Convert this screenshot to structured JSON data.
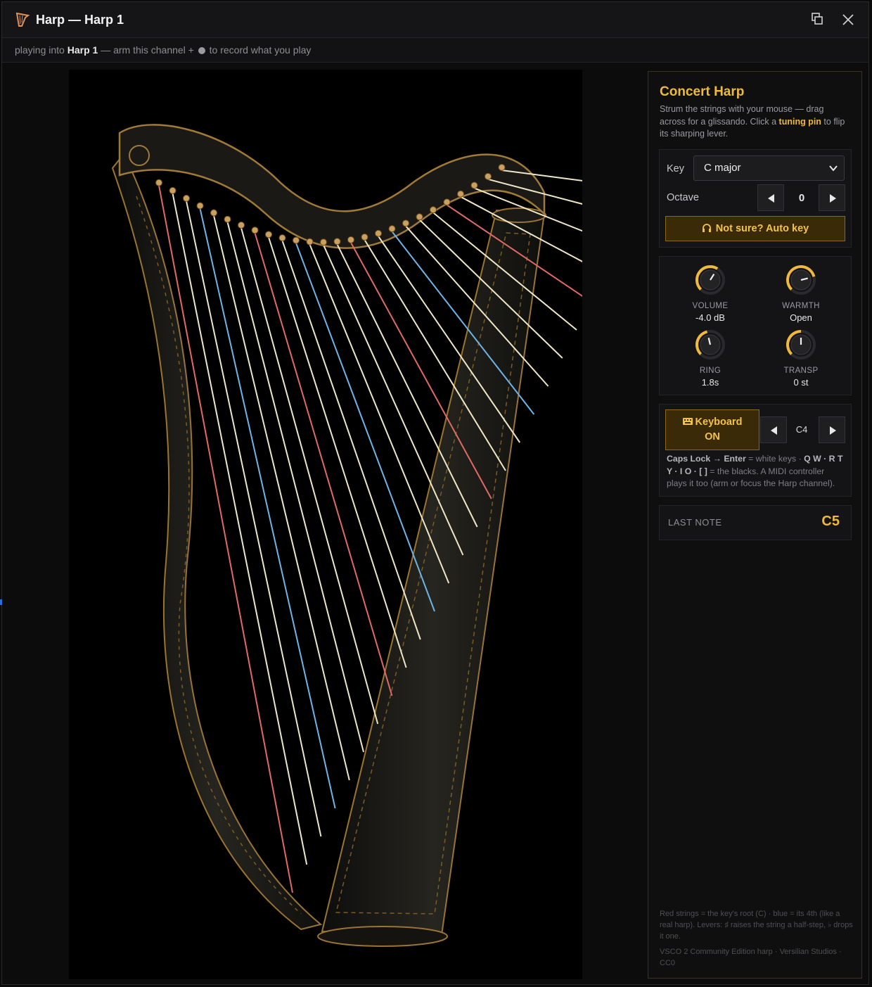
{
  "window": {
    "title": "Harp — Harp 1",
    "subtitle": {
      "prefix": "playing into",
      "channel": "Harp 1",
      "middle": "— arm this channel +",
      "suffix": "to record what you play"
    }
  },
  "panel": {
    "title": "Concert Harp",
    "description": {
      "part1": "Strum the strings with your mouse — drag across for a glissando. Click a",
      "highlight": "tuning pin",
      "part2": "to flip its sharping lever."
    },
    "key": {
      "label": "Key",
      "value": "C major"
    },
    "octave": {
      "label": "Octave",
      "value": "0"
    },
    "auto_key_label": "Not sure? Auto key",
    "knobs": [
      {
        "label": "VOLUME",
        "value": "-4.0 dB",
        "level": 0.62
      },
      {
        "label": "WARMTH",
        "value": "Open",
        "level": 0.78
      },
      {
        "label": "RING",
        "value": "1.8s",
        "level": 0.45
      },
      {
        "label": "TRANSP",
        "value": "0 st",
        "level": 0.5
      }
    ],
    "keyboard": {
      "button_line1": "Keyboard",
      "button_line2": "ON",
      "note": "C4",
      "help": {
        "b1": "Caps Lock → Enter",
        "t1": "= white keys ·",
        "b2": "Q W · R T Y · I O · [ ]",
        "t2": "= the blacks. A MIDI controller plays it too (arm or focus the Harp channel)."
      }
    },
    "last_note": {
      "label": "LAST NOTE",
      "value": "C5"
    },
    "footer": {
      "legend": "Red strings = the key's root (C) · blue = its 4th (like a real harp). Levers: ♯ raises the string a half-step, ♭ drops it one.",
      "credit": "VSCO 2 Community Edition harp · Versilian Studios · CC0"
    }
  },
  "colors": {
    "accent": "#f0b93a",
    "root_string": "#e06a66",
    "fourth_string": "#6fb4e6",
    "string": "#efe6c6",
    "wood": "#1c1b17",
    "gold": "#b88a3a"
  }
}
